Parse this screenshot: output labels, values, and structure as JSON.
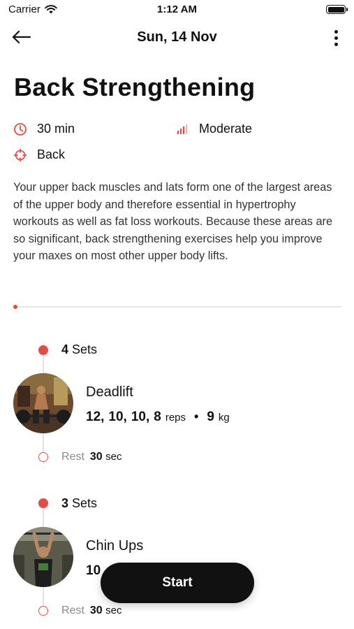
{
  "status_bar": {
    "carrier": "Carrier",
    "time": "1:12 AM"
  },
  "nav": {
    "title": "Sun, 14 Nov"
  },
  "workout": {
    "title": "Back Strengthening",
    "duration": "30 min",
    "difficulty": "Moderate",
    "target": "Back",
    "description": "Your upper back muscles and lats form one of the largest areas of the upper body and therefore essential in hypertrophy workouts as well as fat loss workouts. Because these areas are so significant, back strengthening exercises help you improve your maxes on most other upper body lifts.",
    "progress": 0
  },
  "exercises": [
    {
      "sets_count": "4",
      "sets_label": "Sets",
      "name": "Deadlift",
      "reps": [
        "12,",
        "10,",
        "10,",
        "8"
      ],
      "reps_unit": "reps",
      "separator": "•",
      "weight": "9",
      "weight_unit": "kg",
      "rest_label": "Rest",
      "rest_value": "30",
      "rest_unit": "sec"
    },
    {
      "sets_count": "3",
      "sets_label": "Sets",
      "name": "Chin Ups",
      "reps_partial": "10",
      "rest_label": "Rest",
      "rest_value": "30",
      "rest_unit": "sec"
    }
  ],
  "actions": {
    "start_label": "Start"
  },
  "colors": {
    "accent": "#e84a3f",
    "button": "#111111",
    "muted": "#8a8a8a"
  },
  "icons": [
    "wifi-icon",
    "battery-icon",
    "back-arrow-icon",
    "more-vertical-icon",
    "clock-icon",
    "signal-bars-icon",
    "target-icon"
  ]
}
